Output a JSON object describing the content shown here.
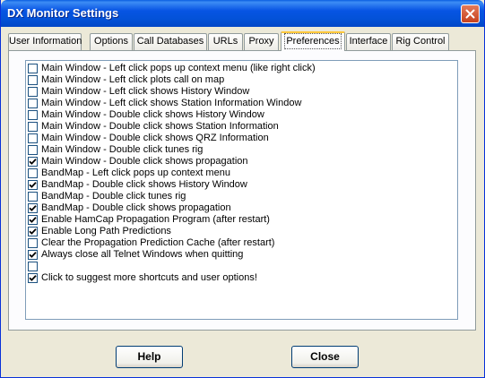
{
  "window": {
    "title": "DX Monitor Settings"
  },
  "tabs": [
    {
      "label": "User Information",
      "active": false
    },
    {
      "label": "Options",
      "active": false
    },
    {
      "label": "Call Databases",
      "active": false
    },
    {
      "label": "URLs",
      "active": false
    },
    {
      "label": "Proxy",
      "active": false
    },
    {
      "label": "Preferences",
      "active": true
    },
    {
      "label": "Interface",
      "active": false
    },
    {
      "label": "Rig Control",
      "active": false
    }
  ],
  "preferences": [
    {
      "label": "Main Window - Left click pops up context menu (like right click)",
      "checked": false
    },
    {
      "label": "Main Window - Left click plots call on map",
      "checked": false
    },
    {
      "label": "Main Window - Left click shows History Window",
      "checked": false
    },
    {
      "label": "Main Window - Left click shows Station Information Window",
      "checked": false
    },
    {
      "label": "Main Window - Double click shows History Window",
      "checked": false
    },
    {
      "label": "Main Window - Double click shows Station Information",
      "checked": false
    },
    {
      "label": "Main Window - Double click shows QRZ Information",
      "checked": false
    },
    {
      "label": "Main Window - Double click tunes rig",
      "checked": false
    },
    {
      "label": "Main Window - Double click shows propagation",
      "checked": true
    },
    {
      "label": "BandMap - Left click pops up context menu",
      "checked": false
    },
    {
      "label": "BandMap - Double click shows History Window",
      "checked": true
    },
    {
      "label": "BandMap - Double click tunes rig",
      "checked": false
    },
    {
      "label": "BandMap - Double click shows propagation",
      "checked": true
    },
    {
      "label": "Enable HamCap Propagation Program (after restart)",
      "checked": true
    },
    {
      "label": "Enable Long Path Predictions",
      "checked": true
    },
    {
      "label": "Clear the Propagation Prediction Cache (after restart)",
      "checked": false
    },
    {
      "label": "Always close all Telnet Windows when quitting",
      "checked": true
    },
    {
      "label": "",
      "checked": false
    },
    {
      "label": "Click to suggest more shortcuts and user options!",
      "checked": true
    }
  ],
  "buttons": {
    "help": "Help",
    "close": "Close"
  },
  "colors": {
    "titlebar": "#0a5fe0",
    "active_tab_highlight": "#ffc83c",
    "dialog_bg": "#ece9d8",
    "checkmark": "#21a121"
  }
}
